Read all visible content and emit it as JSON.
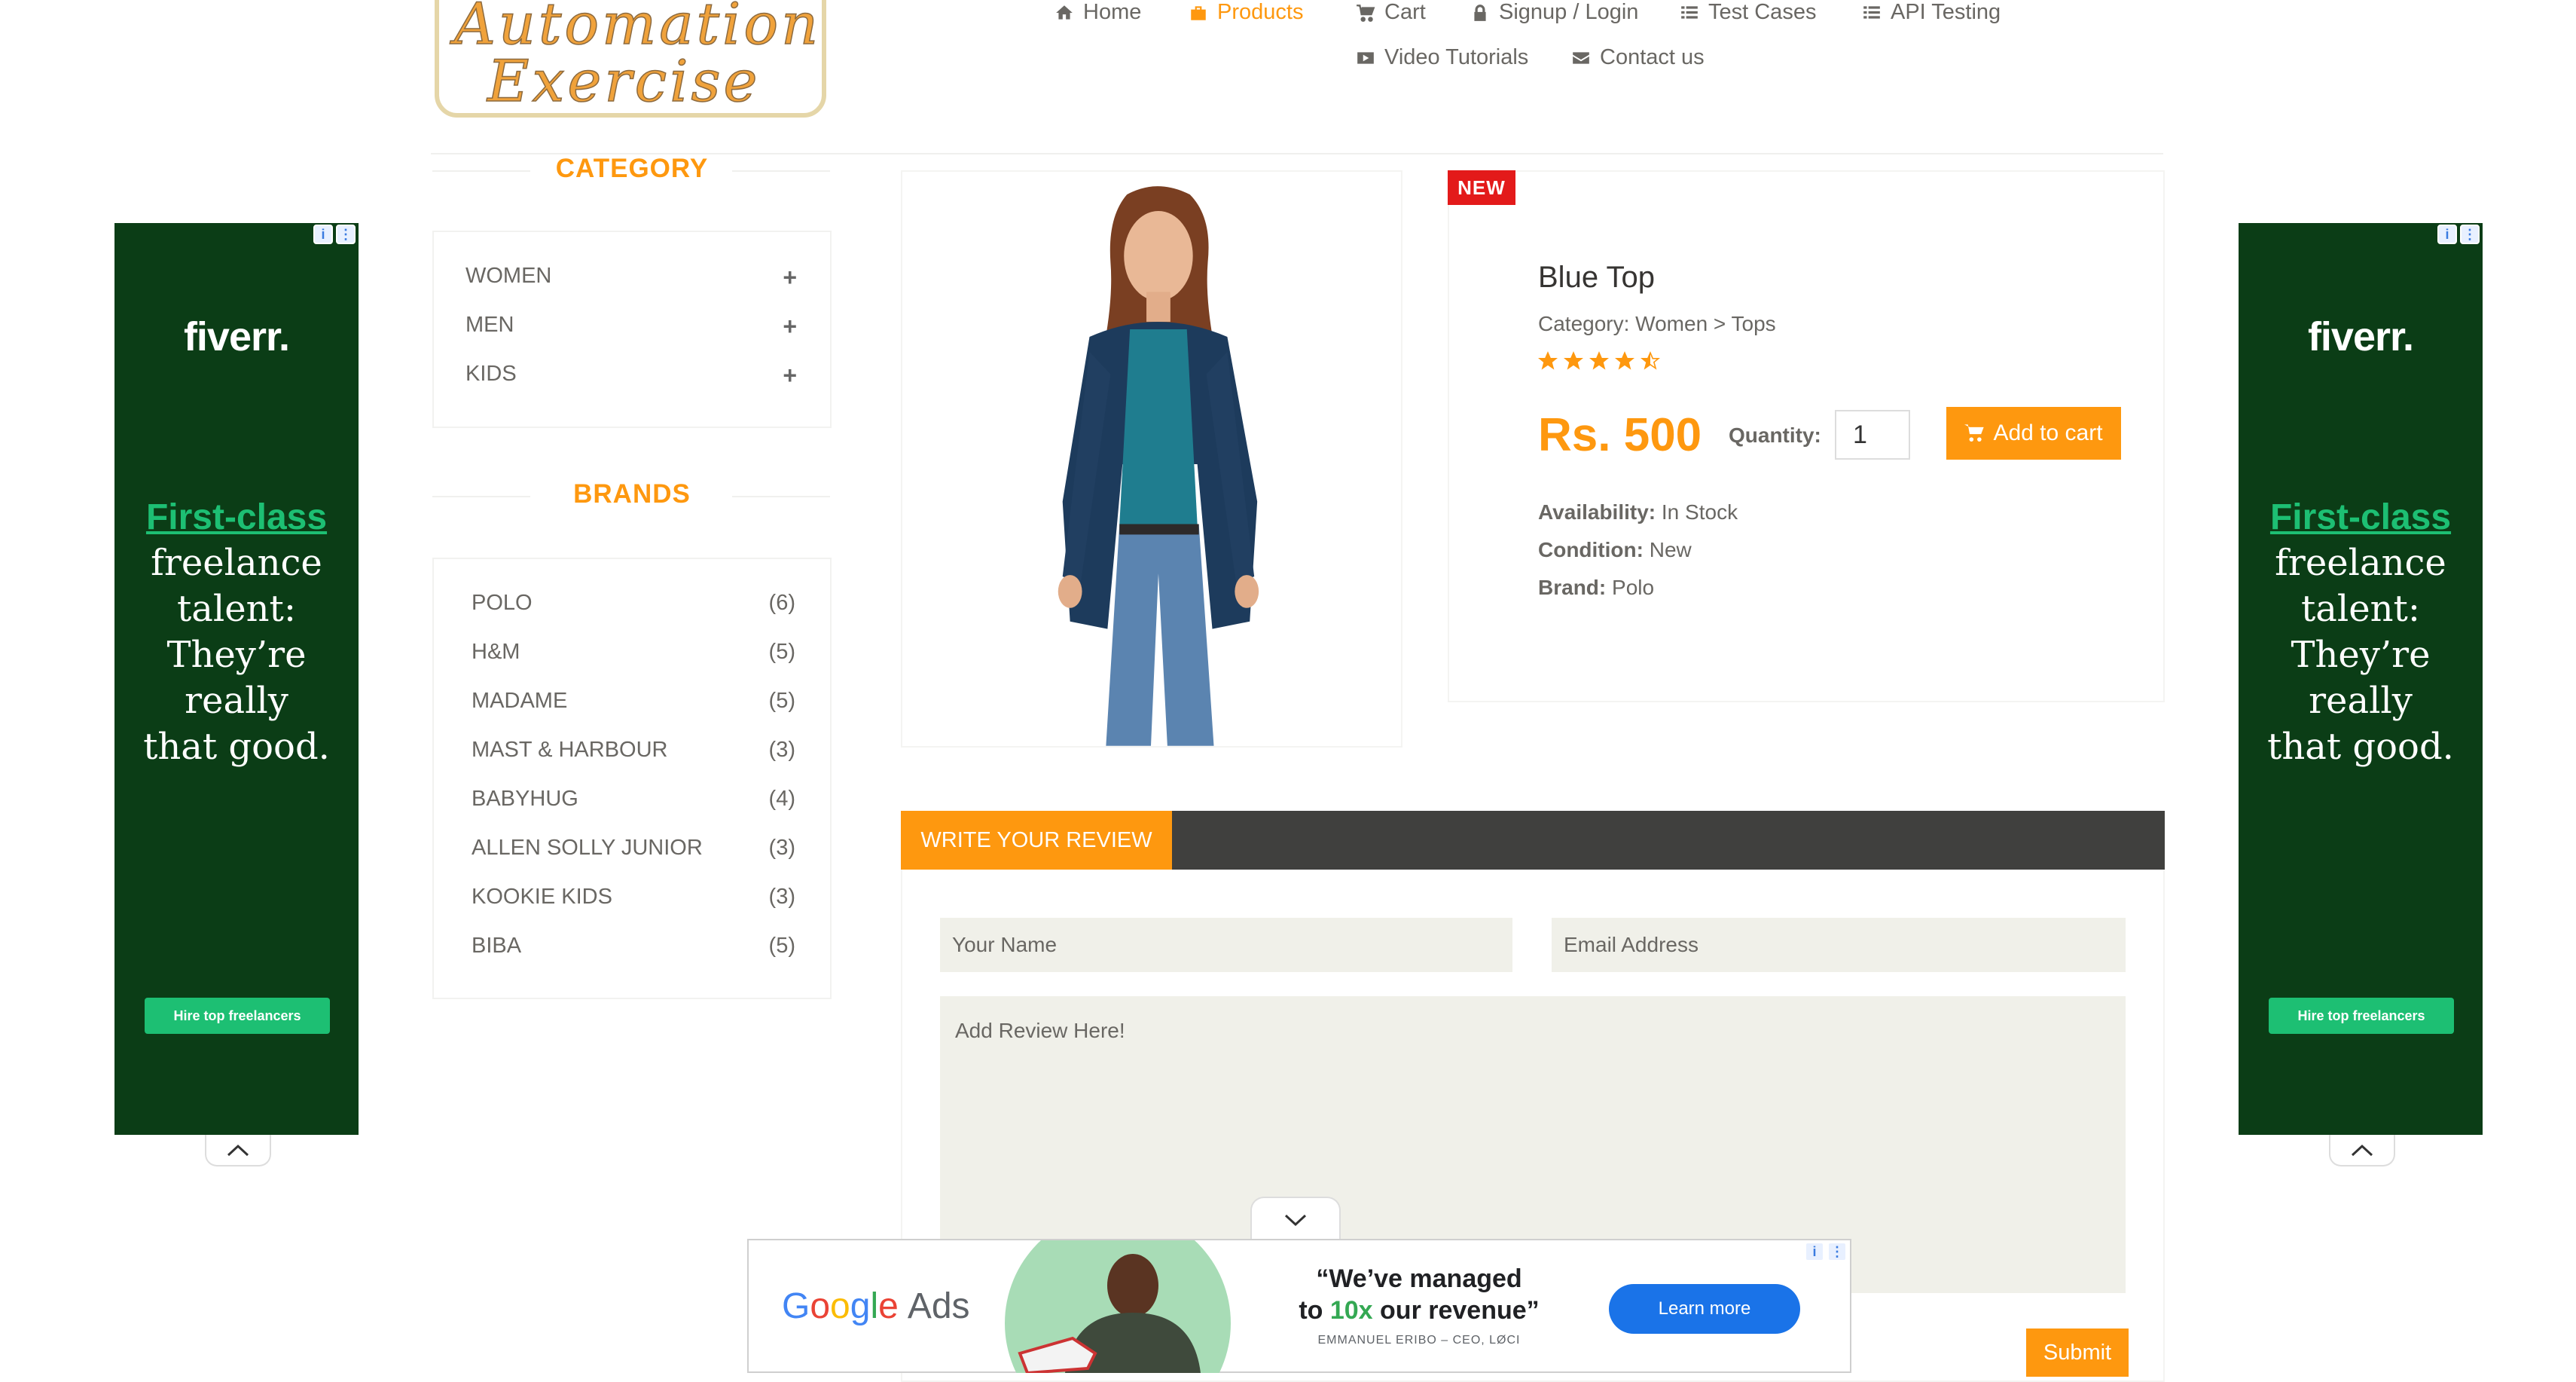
{
  "logo": {
    "line1": "Automation",
    "line2": "Exercise"
  },
  "nav": {
    "home": "Home",
    "products": "Products",
    "cart": "Cart",
    "signup": "Signup / Login",
    "test_cases": "Test Cases",
    "api_testing": "API Testing",
    "video_tutorials": "Video Tutorials",
    "contact": "Contact us"
  },
  "sidebar": {
    "category_title": "CATEGORY",
    "categories": [
      "WOMEN",
      "MEN",
      "KIDS"
    ],
    "brands_title": "BRANDS",
    "brands": [
      {
        "name": "POLO",
        "count": "(6)"
      },
      {
        "name": "H&M",
        "count": "(5)"
      },
      {
        "name": "MADAME",
        "count": "(5)"
      },
      {
        "name": "MAST & HARBOUR",
        "count": "(3)"
      },
      {
        "name": "BABYHUG",
        "count": "(4)"
      },
      {
        "name": "ALLEN SOLLY JUNIOR",
        "count": "(3)"
      },
      {
        "name": "KOOKIE KIDS",
        "count": "(3)"
      },
      {
        "name": "BIBA",
        "count": "(5)"
      }
    ]
  },
  "product": {
    "badge": "NEW",
    "name": "Blue Top",
    "category": "Category: Women > Tops",
    "rating": 4.5,
    "price": "Rs. 500",
    "quantity_label": "Quantity:",
    "quantity": "1",
    "add_to_cart": "Add to cart",
    "availability_label": "Availability:",
    "availability": "In Stock",
    "condition_label": "Condition:",
    "condition": "New",
    "brand_label": "Brand:",
    "brand": "Polo"
  },
  "review": {
    "tab": "WRITE YOUR REVIEW",
    "name_placeholder": "Your Name",
    "email_placeholder": "Email Address",
    "review_placeholder": "Add Review Here!",
    "submit": "Submit"
  },
  "side_ad": {
    "brand": "fiverr.",
    "highlight": "First-class",
    "line1": "freelance",
    "line2": "talent:",
    "line3": "They’re",
    "line4": "really",
    "line5": "that good.",
    "button": "Hire top freelancers",
    "bg_color": "#0b3d16",
    "accent": "#1dbf73"
  },
  "bottom_ad": {
    "brand_google": [
      "G",
      "o",
      "o",
      "g",
      "l",
      "e"
    ],
    "brand_ads": "Ads",
    "quote_line1": "“We’ve managed",
    "quote_to": "to ",
    "quote_highlight": "10x",
    "quote_rest": " our revenue”",
    "attribution": "EMMANUEL ERIBO – CEO, LØCI",
    "button": "Learn more"
  },
  "colors": {
    "accent": "#fe980f",
    "dark_bar": "#40403e",
    "badge": "#e31a1a"
  }
}
